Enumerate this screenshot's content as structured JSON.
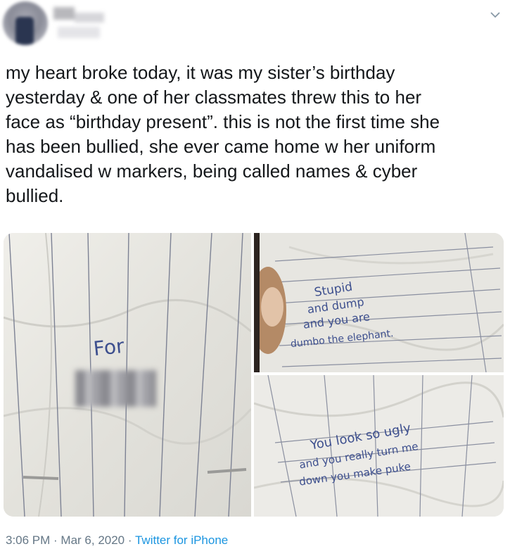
{
  "tweet": {
    "text": "my heart broke today, it was my sister’s birthday\nyesterday & one of her classmates threw this to her\nface as “birthday present”. this is not the first time she\nhas been bullied, she ever came home w her uniform\nvandalised w markers, being called names & cyber\nbullied.",
    "time": "3:06 PM",
    "separator1": " · ",
    "date": "Mar 6, 2020",
    "separator2": " · ",
    "source": "Twitter for iPhone"
  },
  "photos": {
    "left": {
      "note_word": "For"
    },
    "top_right": {
      "line1": "Stupid",
      "line2": "and dump",
      "line3": "and you are",
      "line4": "dumbo the elephant."
    },
    "bottom_right": {
      "line1": "You look so ugly",
      "line2": "and you really turn me",
      "line3": "down you make puke"
    }
  },
  "colors": {
    "text": "#14171a",
    "meta": "#657786",
    "link": "#1b95e0",
    "ink": "#3d4f8e"
  }
}
